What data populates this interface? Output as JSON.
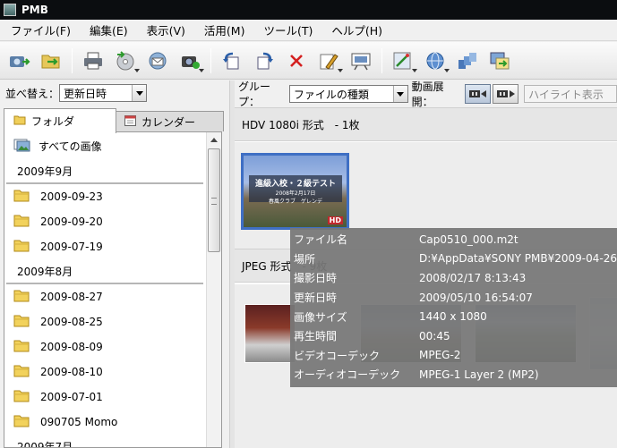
{
  "window": {
    "title": "PMB"
  },
  "menu": [
    "ファイル(F)",
    "編集(E)",
    "表示(V)",
    "活用(M)",
    "ツール(T)",
    "ヘルプ(H)"
  ],
  "toolbar": {
    "icons": [
      "import-icon",
      "folder-import-icon",
      "print-icon",
      "disc-burn-icon",
      "email-icon",
      "camera-icon",
      "rotate-left-icon",
      "rotate-right-icon",
      "delete-icon",
      "edit-icon",
      "slideshow-icon",
      "adjust-icon",
      "web-icon",
      "organize-icon",
      "export-icon"
    ]
  },
  "left_panel": {
    "sort_label": "並べ替え：",
    "sort_value": "更新日時",
    "tabs": {
      "folder": "フォルダ",
      "calendar": "カレンダー"
    },
    "all_images": "すべての画像",
    "groups": [
      {
        "header": "2009年9月",
        "items": [
          "2009-09-23",
          "2009-09-20",
          "2009-07-19"
        ]
      },
      {
        "header": "2009年8月",
        "items": [
          "2009-08-27",
          "2009-08-25",
          "2009-08-09",
          "2009-08-10",
          "2009-07-01",
          "090705 Momo"
        ]
      },
      {
        "header": "2009年7月",
        "items": []
      }
    ]
  },
  "right_panel": {
    "group_label": "グループ：",
    "group_value": "ファイルの種類",
    "video_expand_label": "動画展開：",
    "highlight_value": "ハイライト表示",
    "sections": [
      {
        "title": "HDV 1080i 形式　- 1枚"
      },
      {
        "title": "JPEG 形式　- 9枚"
      }
    ],
    "video_thumb": {
      "line1": "進級入校・２級テスト",
      "line2": "2008年2月17日",
      "line3": "春風クラブ　ゲレンデ",
      "badge": "HD"
    }
  },
  "tooltip": {
    "rows": [
      {
        "key": "ファイル名",
        "value": "Cap0510_000.m2t"
      },
      {
        "key": "場所",
        "value": "D:¥AppData¥SONY PMB¥2009-04-26"
      },
      {
        "key": "撮影日時",
        "value": "2008/02/17 8:13:43"
      },
      {
        "key": "更新日時",
        "value": "2009/05/10 16:54:07"
      },
      {
        "key": "画像サイズ",
        "value": "1440 x 1080"
      },
      {
        "key": "再生時間",
        "value": "00:45"
      },
      {
        "key": "ビデオコーデック",
        "value": "MPEG-2"
      },
      {
        "key": "オーディオコーデック",
        "value": "MPEG-1 Layer 2 (MP2)"
      }
    ]
  }
}
